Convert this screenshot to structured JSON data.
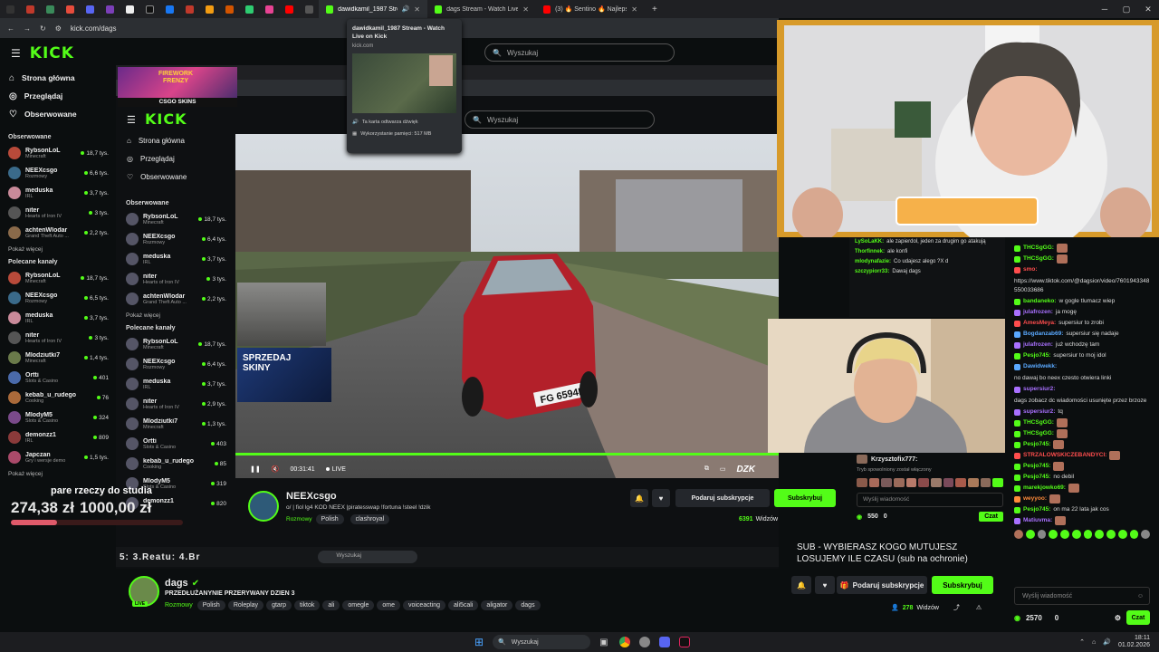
{
  "browser": {
    "tabs": [
      {
        "title": "dawidkamil_1987 Stream - Watch Live on Kick",
        "active": true
      },
      {
        "title": "dags Stream - Watch Live on Kick",
        "active": false
      },
      {
        "title": "(3) 🔥 Sentino 🔥 Najlepsze",
        "active": false
      }
    ],
    "url": "kick.com/dags",
    "tooltip": {
      "title": "dawidkamil_1987 Stream - Watch Live on Kick",
      "domain": "kick.com",
      "mute_label": "Ta karta odtwarza dźwięk",
      "memory_label": "Wykorzystanie pamięci: 517 MB"
    }
  },
  "kick": {
    "logo": "KICK",
    "search_placeholder": "Wyszukaj",
    "nav": [
      {
        "label": "Strona główna",
        "icon": "home-icon"
      },
      {
        "label": "Przeglądaj",
        "icon": "compass-icon"
      },
      {
        "label": "Obserwowane",
        "icon": "heart-icon"
      }
    ],
    "followed_header": "Obserwowane",
    "followed": [
      {
        "name": "RybsonLoL",
        "category": "Minecraft",
        "viewers": "18,7 tys.",
        "color": "#b84a3a"
      },
      {
        "name": "NEEXcsgo",
        "category": "Rozmowy",
        "viewers": "6,6 tys.",
        "color": "#3a6a8a"
      },
      {
        "name": "meduska",
        "category": "IRL",
        "viewers": "3,7 tys.",
        "color": "#c98a9a"
      },
      {
        "name": "niter",
        "category": "Hearts of Iron IV",
        "viewers": "3 tys.",
        "color": "#555"
      },
      {
        "name": "achtenWlodar",
        "category": "Grand Theft Auto ...",
        "viewers": "2,2 tys.",
        "color": "#8a6a4a"
      }
    ],
    "show_more": "Pokaż więcej",
    "recommended_header": "Polecane kanały",
    "recommended": [
      {
        "name": "RybsonLoL",
        "category": "Minecraft",
        "viewers": "18,7 tys.",
        "color": "#b84a3a"
      },
      {
        "name": "NEEXcsgo",
        "category": "Rozmowy",
        "viewers": "6,5 tys.",
        "color": "#3a6a8a"
      },
      {
        "name": "meduska",
        "category": "IRL",
        "viewers": "3,7 tys.",
        "color": "#c98a9a"
      },
      {
        "name": "niter",
        "category": "Hearts of Iron IV",
        "viewers": "3 tys.",
        "color": "#555"
      },
      {
        "name": "Mlodziutki7",
        "category": "Minecraft",
        "viewers": "1,4 tys.",
        "color": "#6a7a4a"
      },
      {
        "name": "Ortti",
        "category": "Slots & Casino",
        "viewers": "401",
        "color": "#4a6aaa"
      },
      {
        "name": "kebab_u_rudego",
        "category": "Cooking",
        "viewers": "76",
        "color": "#aa6a3a"
      },
      {
        "name": "MlodyM5",
        "category": "Slots & Casino",
        "viewers": "324",
        "color": "#7a4a8a"
      },
      {
        "name": "demonzz1",
        "category": "IRL",
        "viewers": "809",
        "color": "#8a3a3a"
      },
      {
        "name": "Japczan",
        "category": "Gry i wersje demo",
        "viewers": "1,5 tys.",
        "color": "#aa4a6a"
      }
    ],
    "show_more2": "Pokaż więcej",
    "nested_recommended": [
      {
        "name": "RybsonLoL",
        "category": "Minecraft",
        "viewers": "18,7 tys."
      },
      {
        "name": "NEEXcsgo",
        "category": "Rozmowy",
        "viewers": "6,4 tys."
      },
      {
        "name": "meduska",
        "category": "IRL",
        "viewers": "3,7 tys."
      },
      {
        "name": "niter",
        "category": "Hearts of Iron IV",
        "viewers": "2,9 tys."
      },
      {
        "name": "Mlodziutki7",
        "category": "Minecraft",
        "viewers": "1,3 tys."
      },
      {
        "name": "Ortti",
        "category": "Slots & Casino",
        "viewers": "403"
      },
      {
        "name": "kebab_u_rudego",
        "category": "Cooking",
        "viewers": "85"
      },
      {
        "name": "MlodyM5",
        "category": "Slots & Casino",
        "viewers": "319"
      },
      {
        "name": "demonzz1",
        "category": "IRL",
        "viewers": "820"
      }
    ],
    "nested_followed": [
      {
        "name": "RybsonLoL",
        "category": "Minecraft",
        "viewers": "18,7 tys."
      },
      {
        "name": "NEEXcsgo",
        "category": "Rozmowy",
        "viewers": "6,4 tys."
      },
      {
        "name": "meduska",
        "category": "IRL",
        "viewers": "3,7 tys."
      },
      {
        "name": "niter",
        "category": "Hearts of Iron IV",
        "viewers": "3 tys."
      },
      {
        "name": "achtenWlodar",
        "category": "Grand Theft Auto ...",
        "viewers": "2,2 tys."
      }
    ]
  },
  "overlay": {
    "goal_text": "pare rzeczy do studia",
    "goal_current": "274,38 zł",
    "goal_target": "1000,00 zł",
    "ticker": "5: 3.Reatu: 4.Br",
    "sub_text_1": "SUB - WYBIERASZ KOGO MUTUJESZ",
    "sub_text_2": "LOSUJEMY ILE CZASU (sub na ochronie)",
    "banner_sell": "SPRZEDAJ SKINY",
    "banner_game": "FIREWORK FRENZY",
    "banner_sponsor": "CSGO SKINS",
    "plate": "FG 6594P",
    "cam_watermark": "DZK"
  },
  "player": {
    "time": "00:31:41",
    "live_label": "LIVE"
  },
  "inner_stream": {
    "name": "NEEXcsgo",
    "title": "o/ | fiol lg4 KOD NEEX |piratesswap !fortuna !steel !dzik",
    "category": "Rozmowy",
    "tags": [
      "Polish",
      "clashroyal"
    ],
    "viewers": "6391",
    "viewers_label": "Widzów",
    "gift_label": "Podaruj subskrypcje",
    "sub_label": "Subskrybuj",
    "chat_placeholder": "Wyślij wiadomość",
    "chat_btn": "Czat",
    "points": "550",
    "points2": "0",
    "chat_user": "Krzysztofix777:",
    "chat_msgs": [
      {
        "user": "LySoLaKK:",
        "text": "ale zapierdol, jeden za drugim go atakują"
      },
      {
        "user": "Thorfinnek:",
        "text": "ale konfi"
      },
      {
        "user": "mlodynafazie:",
        "text": "Co udajesz alego ?X d"
      },
      {
        "user": "szczypiorr33:",
        "text": "Dawaj dags"
      }
    ],
    "slow_mode": "Tryb spowolniony został włączony"
  },
  "stream": {
    "name": "dags",
    "title": "PRZEDŁUŻANYNIE PRZERYWANY DZIEN 3",
    "category": "Rozmowy",
    "tags": [
      "Polish",
      "Roleplay",
      "gtarp",
      "tiktok",
      "ali",
      "omegle",
      "ome",
      "voiceacting",
      "ali5cali",
      "aligator",
      "dags"
    ],
    "viewers": "278",
    "viewers_label": "Widzów",
    "gift_label": "Podaruj subskrypcje",
    "sub_label": "Subskrybuj",
    "live_badge": "LIVE"
  },
  "chat": {
    "placeholder": "Wyślij wiadomość",
    "send_label": "Czat",
    "points": "2570",
    "points2": "0",
    "messages": [
      {
        "user": "THCSgGG:",
        "text": "",
        "color": "#53fc18"
      },
      {
        "user": "THCSgGG:",
        "text": "",
        "color": "#53fc18"
      },
      {
        "user": "smo:",
        "text": "https://www.tiktok.com/@dagsior/video/7601943348550033686",
        "color": "#ff4d4d"
      },
      {
        "user": "bandaneko:",
        "text": "w gogle tlumacz wiep",
        "color": "#53fc18"
      },
      {
        "user": "julafrozen:",
        "text": "ja mogę",
        "color": "#a970ff"
      },
      {
        "user": "AmesMeya:",
        "text": "supersiur to zrobi",
        "color": "#ff4d4d"
      },
      {
        "user": "Bogdanzab69:",
        "text": "supersiur się nadaje",
        "color": "#5aa9ff"
      },
      {
        "user": "julafrozen:",
        "text": "już wchodzę tam",
        "color": "#a970ff"
      },
      {
        "user": "Pesjo745:",
        "text": "supersiur to moj idol",
        "color": "#53fc18"
      },
      {
        "user": "Dawidwekk:",
        "text": "no dawaj bo neex czesto otwiera linki",
        "color": "#5aa9ff"
      },
      {
        "user": "supersiur2:",
        "text": "dags zobacz dc wiadomości usunięte przez brzoze",
        "color": "#a970ff"
      },
      {
        "user": "supersiur2:",
        "text": "tq",
        "color": "#a970ff"
      },
      {
        "user": "THCSgGG:",
        "text": "",
        "color": "#53fc18"
      },
      {
        "user": "THCSgGG:",
        "text": "",
        "color": "#53fc18"
      },
      {
        "user": "Pesjo745:",
        "text": "",
        "color": "#53fc18"
      },
      {
        "user": "STRZALOWSKICZEBANDYCI:",
        "text": "",
        "color": "#ff4d4d"
      },
      {
        "user": "Pesjo745:",
        "text": "",
        "color": "#53fc18"
      },
      {
        "user": "Pesjo745:",
        "text": "no debil",
        "color": "#53fc18"
      },
      {
        "user": "marekjowko69:",
        "text": "",
        "color": "#53fc18"
      },
      {
        "user": "weyyoo:",
        "text": "",
        "color": "#ff8a3a"
      },
      {
        "user": "Pesjo745:",
        "text": "on ma 22 lata jak cos",
        "color": "#53fc18"
      },
      {
        "user": "Matiuvma:",
        "text": "",
        "color": "#a970ff"
      }
    ]
  },
  "taskbar": {
    "search_placeholder": "Wyszukaj",
    "time": "18:11",
    "date": "01.02.2026"
  },
  "colors": {
    "accent": "#53fc18",
    "bg": "#0b0e0f"
  }
}
